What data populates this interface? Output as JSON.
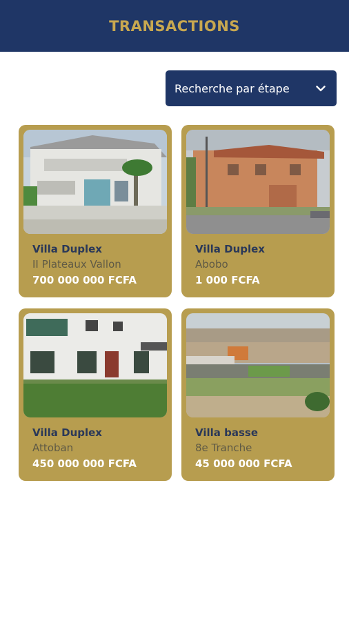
{
  "header": {
    "title": "TRANSACTIONS"
  },
  "filter": {
    "label": "Recherche par étape",
    "icon": "chevron-down-icon"
  },
  "colors": {
    "navy": "#1f3666",
    "gold": "#b79d4f",
    "header_text": "#c8a850"
  },
  "listings": [
    {
      "title": "Villa Duplex",
      "location": "II Plateaux Vallon",
      "price": "700 000 000 FCFA"
    },
    {
      "title": "Villa Duplex",
      "location": "Abobo",
      "price": "1 000 FCFA"
    },
    {
      "title": "Villa Duplex",
      "location": "Attoban",
      "price": "450 000 000 FCFA"
    },
    {
      "title": "Villa basse",
      "location": "8e Tranche",
      "price": "45 000 000 FCFA"
    }
  ]
}
